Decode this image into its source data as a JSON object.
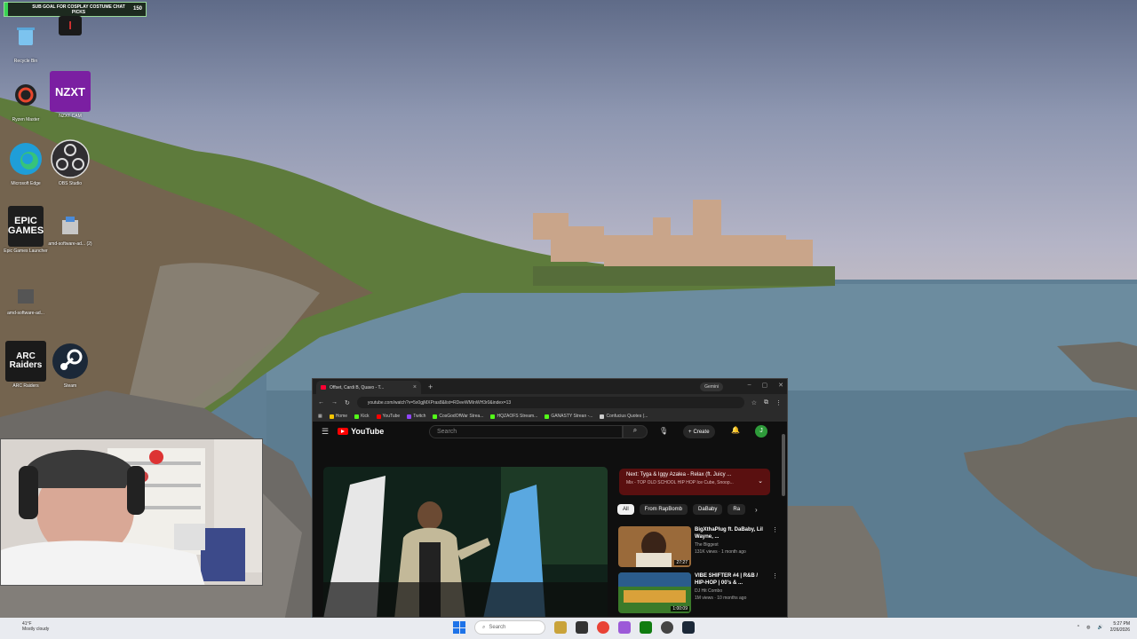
{
  "overlay": {
    "goal_text": "SUB GOAL FOR COSPLAY COSTUME CHAT PICKS",
    "goal_count": "150"
  },
  "desktop_icons": [
    {
      "label": "Recycle Bin",
      "text": ""
    },
    {
      "label": "Ryzen Master",
      "text": ""
    },
    {
      "label": "NZXT CAM",
      "text": "NZXT"
    },
    {
      "label": "Microsoft Edge",
      "text": ""
    },
    {
      "label": "OBS Studio",
      "text": ""
    },
    {
      "label": "Epic Games Launcher",
      "text": "EPIC GAMES"
    },
    {
      "label": "amd-software-ad... (2)",
      "text": ""
    },
    {
      "label": "amd-software-ad...",
      "text": ""
    },
    {
      "label": "ARC Raiders",
      "text": "ARC Raiders"
    },
    {
      "label": "Steam",
      "text": ""
    }
  ],
  "browser": {
    "tab_title": "Offset, Cardi B, Quavo - T...",
    "new_tab": "+",
    "gemini": "Gemini",
    "url": "youtube.com/watch?v=5x0gjMXPras8&list=RDeeWMInWH3r0&index=13",
    "bookmarks": [
      {
        "label": "Home",
        "color": "#f4c400"
      },
      {
        "label": "Kick",
        "color": "#53fc18"
      },
      {
        "label": "YouTube",
        "color": "#ff0000"
      },
      {
        "label": "Twitch",
        "color": "#9146ff"
      },
      {
        "label": "CosGodOfWar Strea...",
        "color": "#53fc18"
      },
      {
        "label": "HQZAOFS Stream...",
        "color": "#53fc18"
      },
      {
        "label": "GANASTY Strean -...",
        "color": "#53fc18"
      },
      {
        "label": "Confucius Quotes (...",
        "color": "#cccccc"
      }
    ]
  },
  "youtube": {
    "logo": "YouTube",
    "search_placeholder": "Search",
    "create_label": "Create",
    "avatar_letter": "J",
    "next_title": "Next: Tyga & Iggy Azalea - Relax (ft. Juicy ...",
    "next_sub": "Mix - TOP OLD SCHOOL HIP HOP Ice Cube, Snoop...",
    "chips": [
      "All",
      "From RapBomb",
      "DaBaby",
      "Ra"
    ],
    "recommendations": [
      {
        "title": "BigXthaPlug ft. DaBaby, Lil Wayne, ...",
        "channel": "The Biggest",
        "views": "131K views · 1 month ago",
        "duration": "27:27",
        "thumb_color": "#9a6a3a"
      },
      {
        "title": "VIBE SHIFTER #4 | R&B / HIP-HOP | 00's & ...",
        "channel": "DJ Hit Combo",
        "views": "1M views · 10 months ago",
        "duration": "1:00:09",
        "thumb_color": "#3a7a2a"
      }
    ]
  },
  "taskbar": {
    "weather_temp": "41°F",
    "weather_desc": "Mostly cloudy",
    "search_placeholder": "Search",
    "time": "5:27 PM",
    "date": "2/26/2026"
  }
}
